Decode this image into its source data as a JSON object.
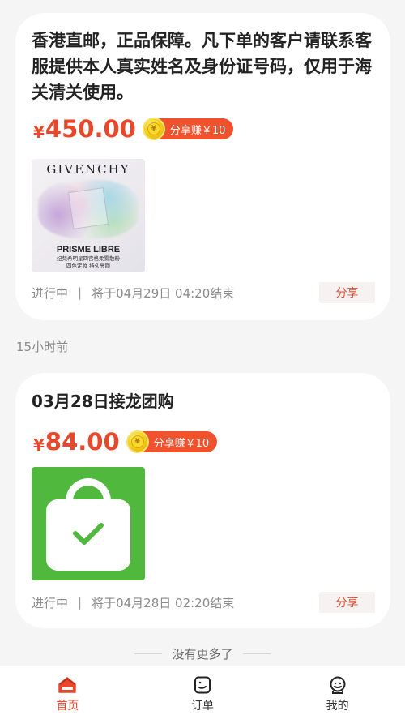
{
  "posts": [
    {
      "title": "香港直邮，正品保障。凡下单的客户请联系客服提供本人真实姓名及身份证号码，仅用于海关清关使用。",
      "currency": "¥",
      "price": "450.00",
      "share_earn": "分享赚￥10",
      "coin_symbol": "¥",
      "image": {
        "brand": "GIVENCHY",
        "product": "PRISME LIBRE",
        "subtitle_line1": "纪梵希明星四宫格柔雾散粉",
        "subtitle_line2": "四色定妆 持久亮颜"
      },
      "status": "进行中",
      "separator": "|",
      "end_time": "将于04月29日 04:20结束",
      "share_label": "分享"
    },
    {
      "title": "03月28日接龙团购",
      "currency": "¥",
      "price": "84.00",
      "share_earn": "分享赚￥10",
      "coin_symbol": "¥",
      "image": {
        "icon": "shopping-bag-check-icon",
        "color": "#4fb83d"
      },
      "status": "进行中",
      "separator": "|",
      "end_time": "将于04月28日 02:20结束",
      "share_label": "分享"
    }
  ],
  "time_ago": "15小时前",
  "no_more": "没有更多了",
  "tabs": [
    {
      "label": "首页",
      "icon": "home-icon",
      "active": true
    },
    {
      "label": "订单",
      "icon": "order-icon",
      "active": false
    },
    {
      "label": "我的",
      "icon": "profile-icon",
      "active": false
    }
  ],
  "colors": {
    "accent": "#e8472c",
    "badge": "#f0522e",
    "background": "#f5f5f5"
  }
}
